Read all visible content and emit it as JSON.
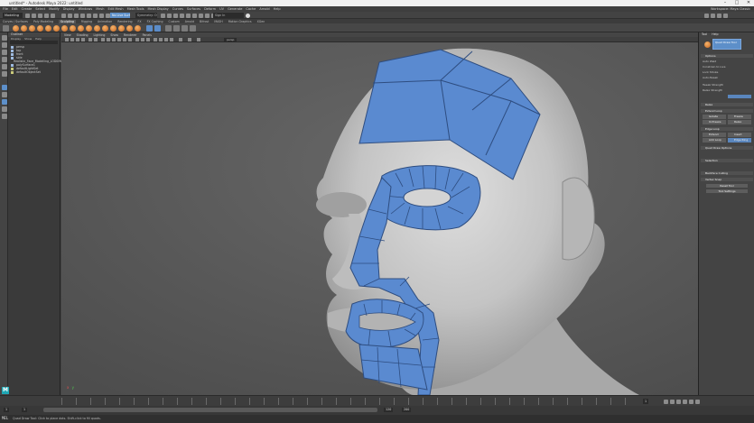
{
  "window": {
    "title": "untitled* - Autodesk Maya 2022: untitled",
    "minimize": "–",
    "maximize": "□",
    "close": "✕"
  },
  "menubar": {
    "items": [
      "File",
      "Edit",
      "Create",
      "Select",
      "Modify",
      "Display",
      "Windows",
      "Mesh",
      "Edit Mesh",
      "Mesh Tools",
      "Mesh Display",
      "Curves",
      "Surfaces",
      "Deform",
      "UV",
      "Generate",
      "Cache",
      "Arnold",
      "Help"
    ],
    "workspace": "Workspace: Maya Classic"
  },
  "statusline": {
    "mode": "Modeling",
    "live_surface": "No Live Surface",
    "symmetry": "Symmetry: Off",
    "sign_in": "Sign In"
  },
  "shelf": {
    "tabs": [
      "Curves / Surfaces",
      "Poly Modeling",
      "Sculpting",
      "Rigging",
      "Animation",
      "Rendering",
      "FX",
      "FX Caching",
      "Custom",
      "Arnold",
      "Bifrost",
      "MASH",
      "Motion Graphics",
      "XGen"
    ],
    "active_tab": "Sculpting"
  },
  "outliner": {
    "title": "Outliner",
    "menu": [
      "Display",
      "Show",
      "Help"
    ],
    "items": [
      "persp",
      "top",
      "front",
      "side",
      "Realistic_Face_Modelling_LOD0Mesh",
      "polySurface1",
      "defaultLightSet",
      "defaultObjectSet"
    ]
  },
  "viewport": {
    "menu": [
      "View",
      "Shading",
      "Lighting",
      "Show",
      "Renderer",
      "Panels"
    ],
    "camera": "persp",
    "axis_x": "x",
    "axis_y": "y"
  },
  "attribute_editor": {
    "tabs": [
      "Tool",
      "Help"
    ],
    "tool_name": "Quad Draw Tool",
    "sections": [
      "Options",
      "Relax",
      "Extend Loop",
      "Edge Loop",
      "Quad Draw Options",
      "Selection",
      "Backface Culling",
      "Vertex Snap"
    ],
    "options_lines": [
      "Auto Weld",
      "Constrain to Live",
      "Lock Stroke",
      "Auto-Tweak",
      "Tweak Strength",
      "Relax Strength"
    ],
    "buttons": [
      "Isolate",
      "Freeze",
      "Unfreeze",
      "Relax",
      "Extend",
      "Insert",
      "Add Loop",
      "Edge Ring"
    ],
    "wide_buttons": [
      "Reset Tool",
      "Tool Settings"
    ]
  },
  "timeslider": {
    "current_frame": "1",
    "start": "1",
    "end": "120",
    "range_start": "1",
    "range_end": "200"
  },
  "helpline": {
    "mel": "MEL",
    "message": "Quad Draw Tool: Click to place dots. Shift-click to fill quads."
  },
  "colors": {
    "quad_mesh": "#5a8ad0",
    "viewport_bg": "#5a5a5a",
    "head_shade": "#c9c9c9",
    "maya_brand": "#1ea7b4"
  }
}
